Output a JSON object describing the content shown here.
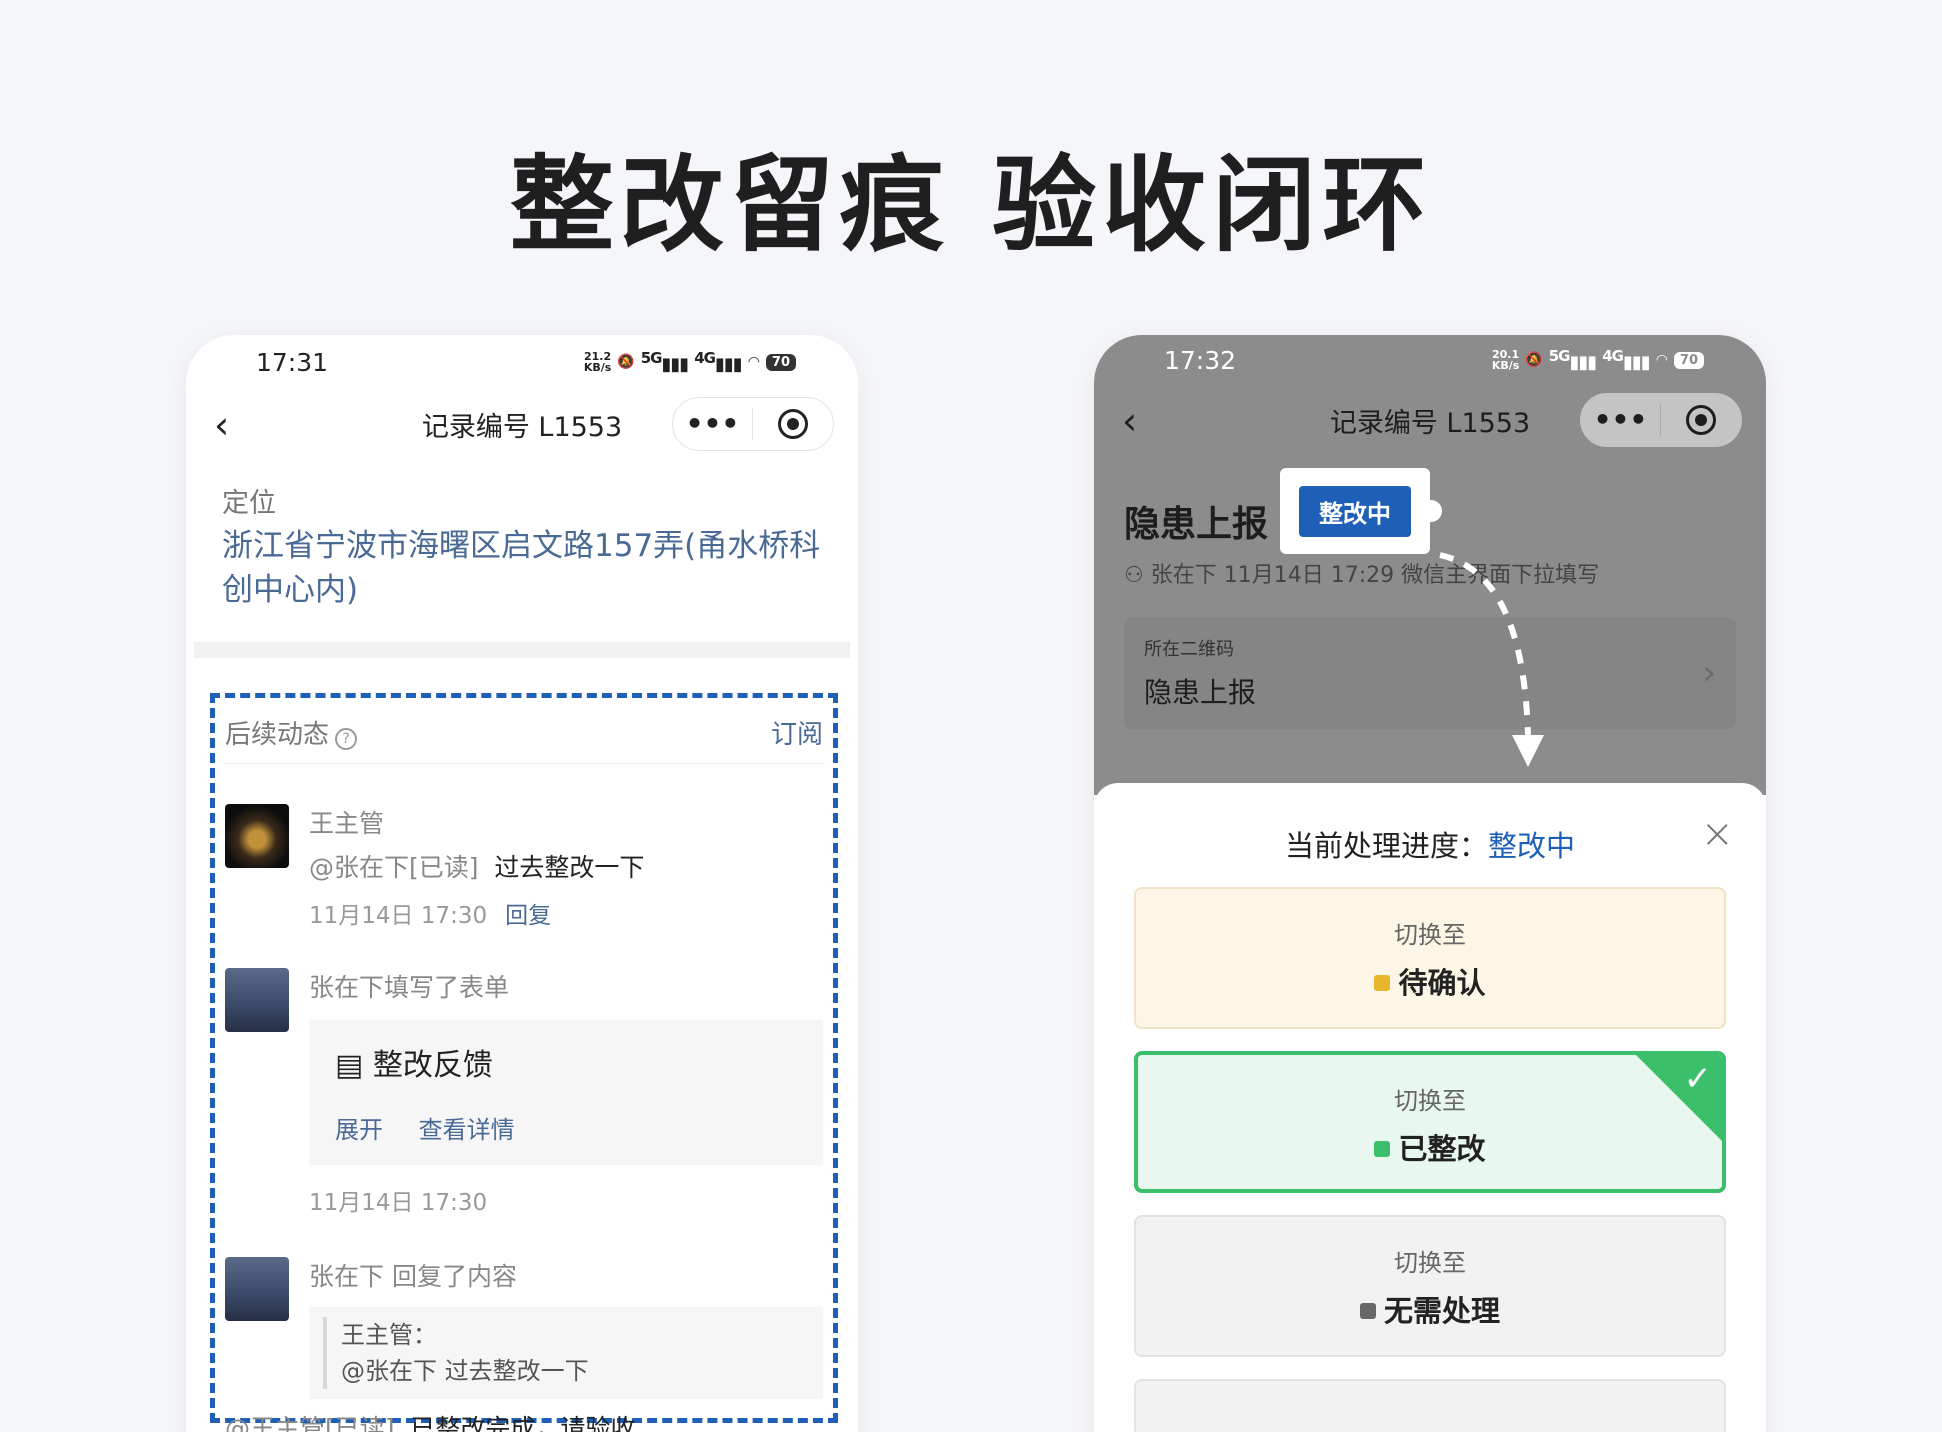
{
  "headline": "整改留痕 验收闭环",
  "colors": {
    "accent": "#1e5fb8",
    "link": "#4a6a96",
    "pending": "#e8b62c",
    "done": "#3bbf6a",
    "none": "#666666"
  },
  "left_phone": {
    "status": {
      "time": "17:31",
      "speed": "21.2",
      "speed_unit": "KB/s",
      "net5g": "5G",
      "net4g": "4G",
      "battery": "70"
    },
    "nav": {
      "back_icon": "‹",
      "title": "记录编号 L1553",
      "more": "•••"
    },
    "location": {
      "label": "定位",
      "address": "浙江省宁波市海曙区启文路157弄(甬水桥科创中心内)"
    },
    "dynamics": {
      "title": "后续动态",
      "help": "?",
      "subscribe": "订阅",
      "entries": [
        {
          "name": "王主管",
          "mention": "@张在下[已读]",
          "text": "过去整改一下",
          "time": "11月14日 17:30",
          "reply": "回复"
        },
        {
          "name": "张在下填写了表单",
          "form_title": "整改反馈",
          "form_links": [
            "展开",
            "查看详情"
          ],
          "time": "11月14日 17:30"
        },
        {
          "name": "张在下 回复了内容",
          "quote_author": "王主管：",
          "quote_text": "@张在下 过去整改一下",
          "mention": "@王主管[已读]",
          "text": "已整改完成，请验收"
        }
      ]
    }
  },
  "right_phone": {
    "status": {
      "time": "17:32",
      "speed": "20.1",
      "speed_unit": "KB/s",
      "net5g": "5G",
      "net4g": "4G",
      "battery": "70"
    },
    "nav": {
      "back_icon": "‹",
      "title": "记录编号 L1553",
      "more": "•••"
    },
    "hazard": {
      "title": "隐患上报",
      "badge": "整改中",
      "meta": "张在下 11月14日 17:29 微信主界面下拉填写"
    },
    "qr": {
      "label": "所在二维码",
      "value": "隐患上报",
      "arrow": "›"
    },
    "sheet": {
      "title_prefix": "当前处理进度：",
      "current": "整改中",
      "close": "×",
      "options": [
        {
          "switch_label": "切换至",
          "status": "待确认"
        },
        {
          "switch_label": "切换至",
          "status": "已整改",
          "selected": true
        },
        {
          "switch_label": "切换至",
          "status": "无需处理"
        }
      ]
    }
  }
}
